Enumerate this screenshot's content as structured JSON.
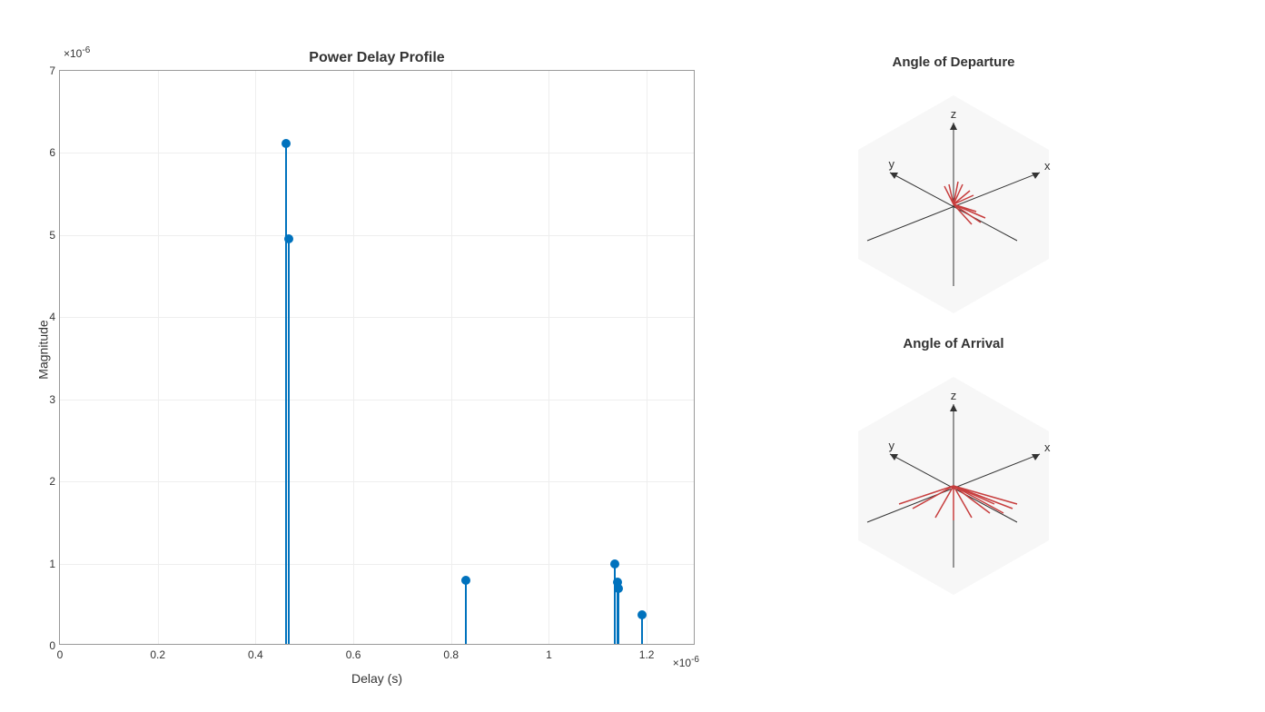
{
  "chart_data": [
    {
      "type": "stem",
      "title": "Power Delay Profile",
      "xlabel": "Delay (s)",
      "ylabel": "Magnitude",
      "xlim": [
        0,
        1.3e-06
      ],
      "ylim": [
        0,
        7e-06
      ],
      "x_exponent": "×10^{-6}",
      "y_exponent": "×10^{-6}",
      "x_ticks": [
        0,
        0.2,
        0.4,
        0.6,
        0.8,
        1,
        1.2
      ],
      "y_ticks": [
        0,
        1,
        2,
        3,
        4,
        5,
        6,
        7
      ],
      "points": [
        {
          "x": 4.63e-07,
          "y": 6.12e-06
        },
        {
          "x": 4.68e-07,
          "y": 4.95e-06
        },
        {
          "x": 8.3e-07,
          "y": 8e-07
        },
        {
          "x": 1.135e-06,
          "y": 1e-06
        },
        {
          "x": 1.14e-06,
          "y": 7.7e-07
        },
        {
          "x": 1.142e-06,
          "y": 7e-07
        },
        {
          "x": 1.19e-06,
          "y": 3.8e-07
        }
      ]
    },
    {
      "type": "vector3d",
      "title": "Angle of Departure",
      "axes_labels": {
        "x": "x",
        "y": "y",
        "z": "z"
      },
      "vectors_note": "Red direction vectors clustered around origin"
    },
    {
      "type": "vector3d",
      "title": "Angle of Arrival",
      "axes_labels": {
        "x": "x",
        "y": "y",
        "z": "z"
      },
      "vectors_note": "Red direction vectors spread near origin"
    }
  ],
  "labels": {
    "main_title": "Power Delay Profile",
    "xlabel": "Delay (s)",
    "ylabel": "Magnitude",
    "exp_y": "×10",
    "exp_y_sup": "-6",
    "exp_x": "×10",
    "exp_x_sup": "-6",
    "aod_title": "Angle of Departure",
    "aoa_title": "Angle of Arrival",
    "ax_x": "x",
    "ax_y": "y",
    "ax_z": "z"
  }
}
